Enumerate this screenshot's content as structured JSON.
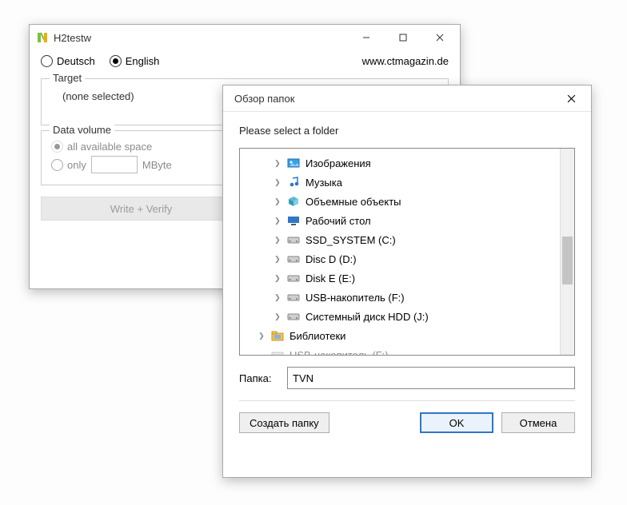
{
  "main": {
    "title": "H2testw",
    "lang": {
      "deutsch": "Deutsch",
      "english": "English",
      "selected": "english"
    },
    "site_link": "www.ctmagazin.de",
    "target_group": "Target",
    "target_value": "(none selected)",
    "dv_group": "Data volume",
    "dv_all": "all available space",
    "dv_only": "only",
    "dv_unit": "MByte",
    "btn_write": "Write + Verify",
    "btn_verify": ""
  },
  "dialog": {
    "title": "Обзор папок",
    "prompt": "Please select a folder",
    "tree": [
      {
        "label": "Изображения",
        "icon": "pictures",
        "level": 1
      },
      {
        "label": "Музыка",
        "icon": "music",
        "level": 1
      },
      {
        "label": "Объемные объекты",
        "icon": "cube",
        "level": 1
      },
      {
        "label": "Рабочий стол",
        "icon": "desktop",
        "level": 1
      },
      {
        "label": "SSD_SYSTEM (C:)",
        "icon": "disk",
        "level": 1
      },
      {
        "label": "Disc D (D:)",
        "icon": "disk",
        "level": 1
      },
      {
        "label": "Disk E (E:)",
        "icon": "disk",
        "level": 1
      },
      {
        "label": "USB-накопитель (F:)",
        "icon": "disk",
        "level": 1
      },
      {
        "label": "Системный диск HDD (J:)",
        "icon": "disk",
        "level": 1
      },
      {
        "label": "Библиотеки",
        "icon": "libraries",
        "level": 0
      },
      {
        "label": "USB-накопитель (F:)",
        "icon": "disk",
        "level": 0,
        "cut": true
      }
    ],
    "folder_label": "Папка:",
    "folder_value": "TVN",
    "btn_new": "Создать папку",
    "btn_ok": "OK",
    "btn_cancel": "Отмена"
  }
}
